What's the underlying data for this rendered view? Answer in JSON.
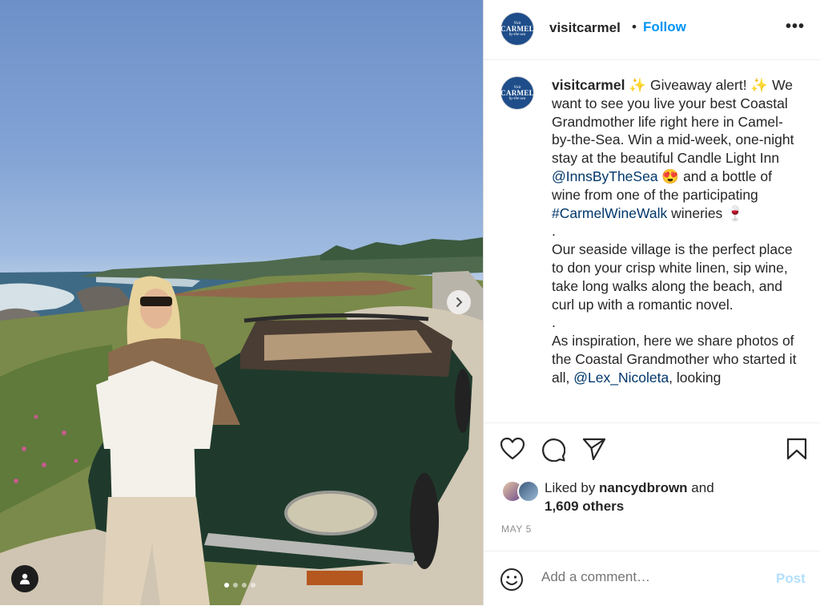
{
  "post": {
    "username": "visitcarmel",
    "separator": "•",
    "follow_label": "Follow",
    "more_label": "•••",
    "avatar_small": "Visit",
    "avatar_big": "CARMEL",
    "avatar_sub": "by-the-sea"
  },
  "caption": {
    "username": "visitcarmel",
    "line1": " ✨ Giveaway alert! ✨ We want to see you live your best Coastal Grandmother life right here in Camel-by-the-Sea. Win a mid-week, one-night stay at the beautiful Candle Light Inn ",
    "mention1": "@InnsByTheSea",
    "part2": " 😍 and a bottle of wine from one of the participating ",
    "hashtag1": "#CarmelWineWalk",
    "part3": " wineries 🍷",
    "dot1": ".",
    "para2": "Our seaside village is the perfect place to don your crisp white linen, sip wine, take long walks along the beach, and curl up with a romantic novel.",
    "dot2": ".",
    "para3": "As inspiration, here we share photos of the Coastal Grandmother who started it all, ",
    "mention2": "@Lex_Nicoleta",
    "para3_end": ", looking"
  },
  "likes": {
    "prefix": "Liked by ",
    "user": "nancydbrown",
    "and": " and",
    "others": "1,609 others"
  },
  "date": "MAY 5",
  "comment": {
    "placeholder": "Add a comment…",
    "post_label": "Post"
  },
  "carousel": {
    "total": 4,
    "active_index": 0
  },
  "icons": {
    "like": "heart-icon",
    "comment": "comment-bubble-icon",
    "share": "paper-plane-icon",
    "save": "bookmark-icon",
    "emoji": "smiley-icon",
    "tag": "user-tag-icon",
    "next": "chevron-right-icon"
  },
  "colors": {
    "follow": "#0095f6",
    "link": "#00376b",
    "post_disabled": "#b2dffc",
    "brand": "#1e4d8a"
  }
}
